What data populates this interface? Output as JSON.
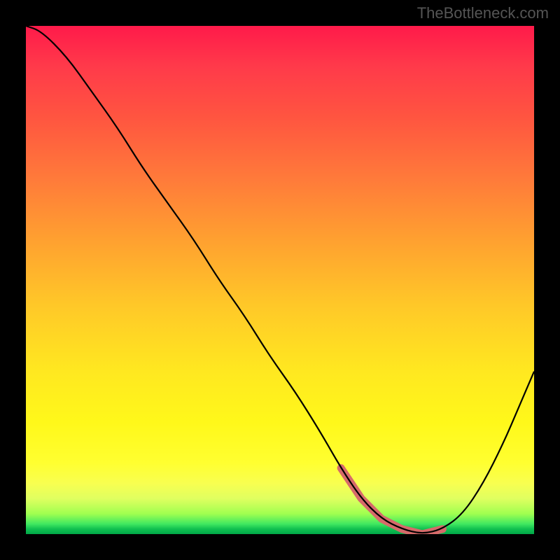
{
  "watermark": "TheBottleneck.com",
  "chart_data": {
    "type": "line",
    "title": "",
    "xlabel": "",
    "ylabel": "",
    "xlim": [
      0,
      100
    ],
    "ylim": [
      0,
      100
    ],
    "series": [
      {
        "name": "curve",
        "x": [
          0,
          3,
          8,
          13,
          18,
          23,
          28,
          33,
          38,
          43,
          48,
          53,
          58,
          62,
          66,
          70,
          74,
          78,
          82,
          86,
          90,
          94,
          97,
          100
        ],
        "values": [
          100,
          99,
          94,
          87,
          80,
          72,
          65,
          58,
          50,
          43,
          35,
          28,
          20,
          13,
          7,
          3,
          1,
          0,
          1,
          4,
          10,
          18,
          25,
          32
        ]
      }
    ],
    "highlight_region": {
      "x_start": 62,
      "x_end": 82,
      "color": "#d66a6a"
    },
    "gradient_stops": [
      {
        "pos": 0,
        "color": "#ff1a4a"
      },
      {
        "pos": 30,
        "color": "#ff7a3a"
      },
      {
        "pos": 55,
        "color": "#ffc828"
      },
      {
        "pos": 86,
        "color": "#ffff30"
      },
      {
        "pos": 100,
        "color": "#00a848"
      }
    ]
  }
}
